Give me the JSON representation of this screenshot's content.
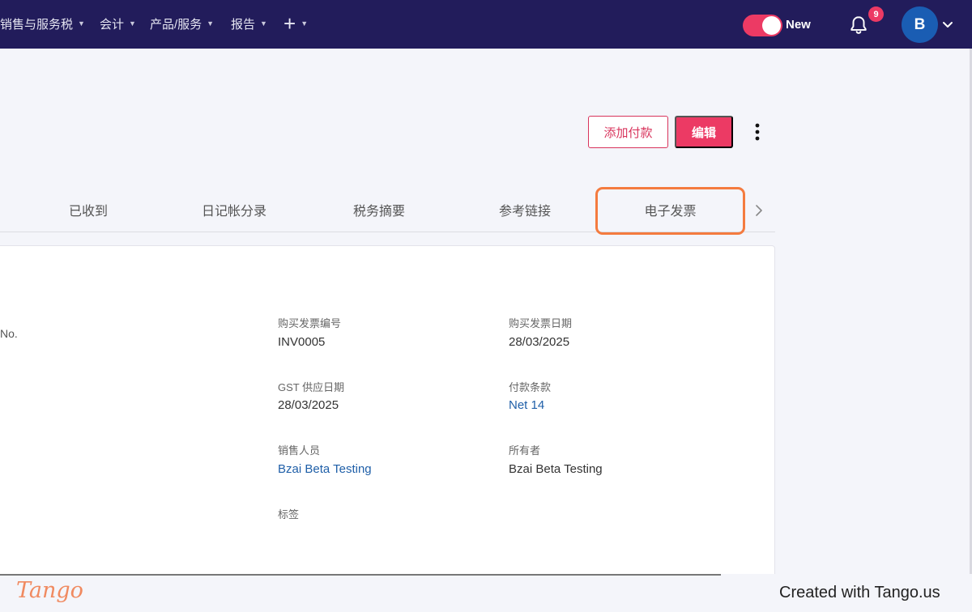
{
  "nav": {
    "items": [
      {
        "label": "销售与服务税"
      },
      {
        "label": "会计"
      },
      {
        "label": "产品/服务"
      },
      {
        "label": "报告"
      }
    ],
    "plus_label": "+",
    "toggle_label": "New",
    "notification_count": "9",
    "avatar_initial": "B"
  },
  "actions": {
    "add_payment": "添加付款",
    "edit": "编辑"
  },
  "tabs": [
    {
      "label": "已收到"
    },
    {
      "label": "日记帐分录"
    },
    {
      "label": "税务摘要"
    },
    {
      "label": "参考链接"
    },
    {
      "label": "电子发票"
    }
  ],
  "details": {
    "cut_label": "No.",
    "purchase_invoice_no": {
      "label": "购买发票编号",
      "value": "INV0005"
    },
    "purchase_invoice_date": {
      "label": "购买发票日期",
      "value": "28/03/2025"
    },
    "gst_supply_date": {
      "label": "GST 供应日期",
      "value": "28/03/2025"
    },
    "payment_terms": {
      "label": "付款条款",
      "value": "Net 14"
    },
    "salesperson": {
      "label": "销售人员",
      "value": "Bzai Beta Testing"
    },
    "owner": {
      "label": "所有者",
      "value": "Bzai Beta Testing"
    },
    "tags": {
      "label": "标签"
    }
  },
  "footer": {
    "logo_text": "Tango",
    "created_with": "Created with Tango.us"
  },
  "colors": {
    "nav_bg": "#221c5b",
    "accent": "#ec3a64",
    "link": "#1f5fa8",
    "highlight": "#f47b3f"
  }
}
